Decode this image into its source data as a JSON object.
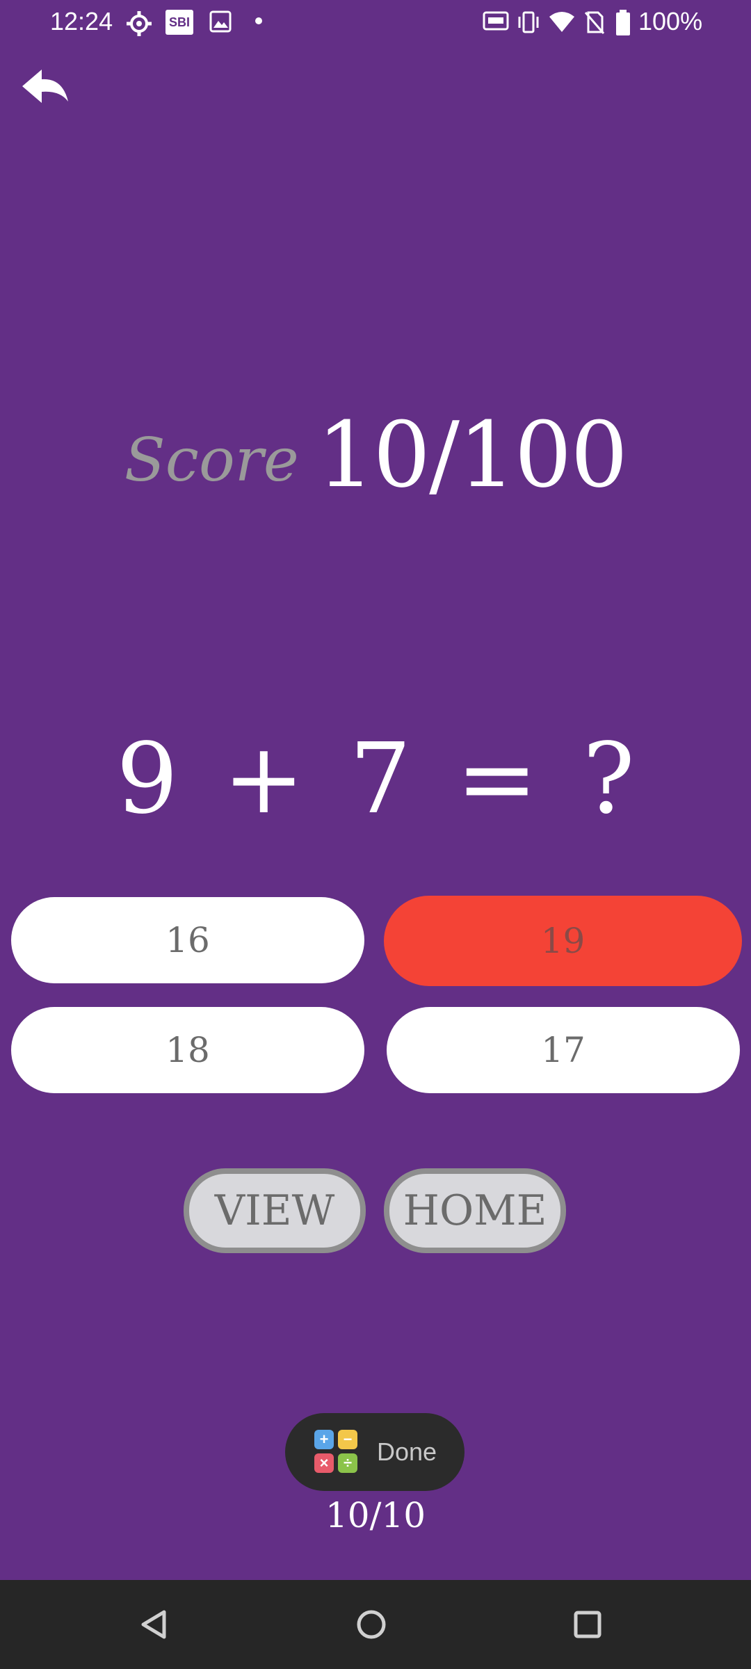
{
  "status_bar": {
    "time": "12:24",
    "sbi_label": "SBI",
    "battery": "100%",
    "icons": [
      "settings-gear-icon",
      "sbi-app-icon",
      "image-icon",
      "dot-icon",
      "auto-hz-icon",
      "vibrate-icon",
      "wifi-icon",
      "no-sim-icon",
      "battery-icon"
    ]
  },
  "back_icon": "back-arrow-icon",
  "score": {
    "label": "Score",
    "value": "10/100"
  },
  "question": {
    "text": "9 + 7 = ?"
  },
  "options": [
    {
      "label": "16",
      "state": "normal"
    },
    {
      "label": "19",
      "state": "wrong"
    },
    {
      "label": "18",
      "state": "normal"
    },
    {
      "label": "17",
      "state": "normal"
    }
  ],
  "buttons": {
    "view": "VIEW",
    "home": "HOME"
  },
  "toast": {
    "text": "Done",
    "icon": "calculator-app-icon"
  },
  "progress": "10/10",
  "colors": {
    "background": "#632f86",
    "wrong": "#f44336",
    "option_bg": "#ffffff",
    "button_bg": "#d8d8dc",
    "nav_bar": "#262626"
  },
  "system_nav": [
    "back-triangle-icon",
    "home-circle-icon",
    "recents-square-icon"
  ]
}
